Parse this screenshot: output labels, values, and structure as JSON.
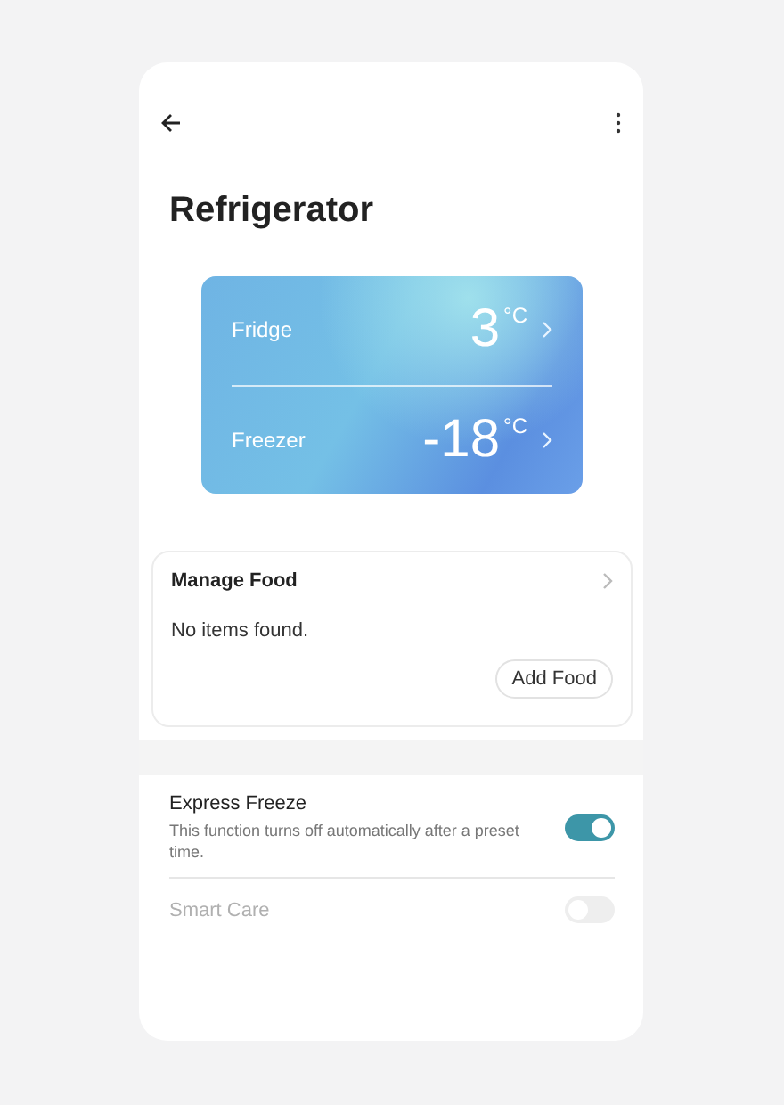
{
  "header": {
    "title": "Refrigerator"
  },
  "temperatures": [
    {
      "label": "Fridge",
      "value": "3",
      "unit": "°C"
    },
    {
      "label": "Freezer",
      "value": "-18",
      "unit": "°C"
    }
  ],
  "manage_food": {
    "title": "Manage Food",
    "message": "No items found.",
    "button": "Add Food"
  },
  "settings": [
    {
      "title": "Express Freeze",
      "description": "This function turns off automatically after a preset time.",
      "on": true,
      "disabled": false
    },
    {
      "title": "Smart Care",
      "on": false,
      "disabled": true
    }
  ]
}
